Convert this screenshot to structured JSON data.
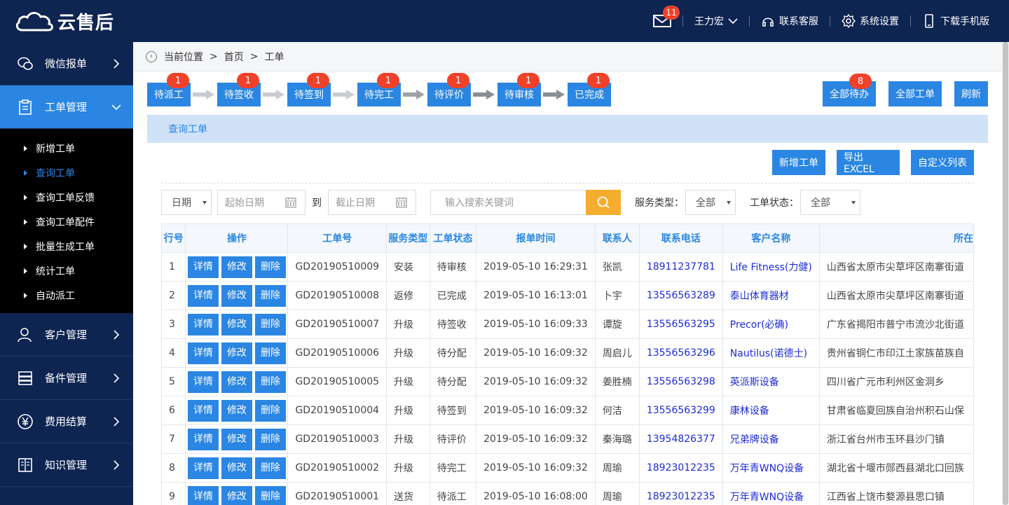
{
  "app": {
    "logo_text": "云售后"
  },
  "topbar": {
    "mail_count": "11",
    "user_name": "王力宏",
    "service_label": "联系客服",
    "settings_label": "系统设置",
    "download_label": "下载手机版"
  },
  "sidebar": {
    "items": [
      {
        "label": "微信报单",
        "icon": "wechat-icon"
      },
      {
        "label": "工单管理",
        "icon": "clipboard-icon",
        "active": true
      },
      {
        "label": "客户管理",
        "icon": "user-icon"
      },
      {
        "label": "备件管理",
        "icon": "server-icon"
      },
      {
        "label": "费用结算",
        "icon": "yen-icon"
      },
      {
        "label": "知识管理",
        "icon": "book-icon"
      }
    ],
    "sub_items": [
      {
        "label": "新增工单"
      },
      {
        "label": "查询工单",
        "active": true
      },
      {
        "label": "查询工单反馈"
      },
      {
        "label": "查询工单配件"
      },
      {
        "label": "批量生成工单"
      },
      {
        "label": "统计工单"
      },
      {
        "label": "自动派工"
      }
    ]
  },
  "breadcrumb": {
    "prefix": "当前位置",
    "home": "首页",
    "current": "工单"
  },
  "steps": [
    {
      "label": "待派工",
      "count": "1"
    },
    {
      "label": "待签收",
      "count": "1"
    },
    {
      "label": "待签到",
      "count": "1"
    },
    {
      "label": "待完工",
      "count": "1"
    },
    {
      "label": "待评价",
      "count": "1"
    },
    {
      "label": "待审核",
      "count": "1"
    },
    {
      "label": "已完成",
      "count": "1"
    }
  ],
  "actions": {
    "all_todo": "全部待办",
    "all_todo_count": "8",
    "all_orders": "全部工单",
    "refresh": "刷新"
  },
  "panel": {
    "title": "查询工单"
  },
  "tools": {
    "new": "新增工单",
    "export": "导出EXCEL",
    "custom": "自定义列表"
  },
  "filters": {
    "date_type": "日期",
    "start_placeholder": "起始日期",
    "to": "到",
    "end_placeholder": "截止日期",
    "search_placeholder": "输入搜索关键词",
    "service_label": "服务类型：",
    "service_value": "全部",
    "status_label": "工单状态：",
    "status_value": "全部"
  },
  "table": {
    "headers": [
      "行号",
      "操作",
      "工单号",
      "服务类型",
      "工单状态",
      "报单时间",
      "联系人",
      "联系电话",
      "客户名称",
      "所在"
    ],
    "op_labels": [
      "详情",
      "修改",
      "删除"
    ],
    "rows": [
      [
        "1",
        "GD20190510009",
        "安装",
        "待审核",
        "2019-05-10 16:29:31",
        "张凯",
        "18911237781",
        "Life Fitness(力健)",
        "山西省太原市尖草坪区南寨街道"
      ],
      [
        "2",
        "GD20190510008",
        "返修",
        "已完成",
        "2019-05-10 16:13:01",
        "卜宇",
        "13556563289",
        "泰山体育器材",
        "山西省太原市尖草坪区南寨街道"
      ],
      [
        "3",
        "GD20190510007",
        "升级",
        "待签收",
        "2019-05-10 16:09:33",
        "谭旋",
        "13556563295",
        "Precor(必确)",
        "广东省揭阳市普宁市流沙北街道"
      ],
      [
        "4",
        "GD20190510006",
        "升级",
        "待分配",
        "2019-05-10 16:09:32",
        "周启儿",
        "13556563296",
        "Nautilus(诺德士)",
        "贵州省铜仁市印江土家族苗族自"
      ],
      [
        "5",
        "GD20190510005",
        "升级",
        "待分配",
        "2019-05-10 16:09:32",
        "姜胜楠",
        "13556563298",
        "英派斯设备",
        "四川省广元市利州区金洞乡"
      ],
      [
        "6",
        "GD20190510004",
        "升级",
        "待签到",
        "2019-05-10 16:09:32",
        "何洁",
        "13556563299",
        "康林设备",
        "甘肃省临夏回族自治州积石山保"
      ],
      [
        "7",
        "GD20190510003",
        "升级",
        "待评价",
        "2019-05-10 16:09:32",
        "秦海璐",
        "13954826377",
        "兄弟牌设备",
        "浙江省台州市玉环县沙门镇"
      ],
      [
        "8",
        "GD20190510002",
        "升级",
        "待完工",
        "2019-05-10 16:09:32",
        "周瑜",
        "18923012235",
        "万年青WNQ设备",
        "湖北省十堰市郧西县湖北口回族"
      ],
      [
        "9",
        "GD20190510001",
        "送货",
        "待派工",
        "2019-05-10 16:08:00",
        "周瑜",
        "18923012235",
        "万年青WNQ设备",
        "江西省上饶市婺源县思口镇"
      ]
    ]
  },
  "colors": {
    "nav_bg": "#0e2451",
    "primary": "#2a86e2",
    "badge": "#f0412a",
    "search": "#f5ad2f"
  }
}
